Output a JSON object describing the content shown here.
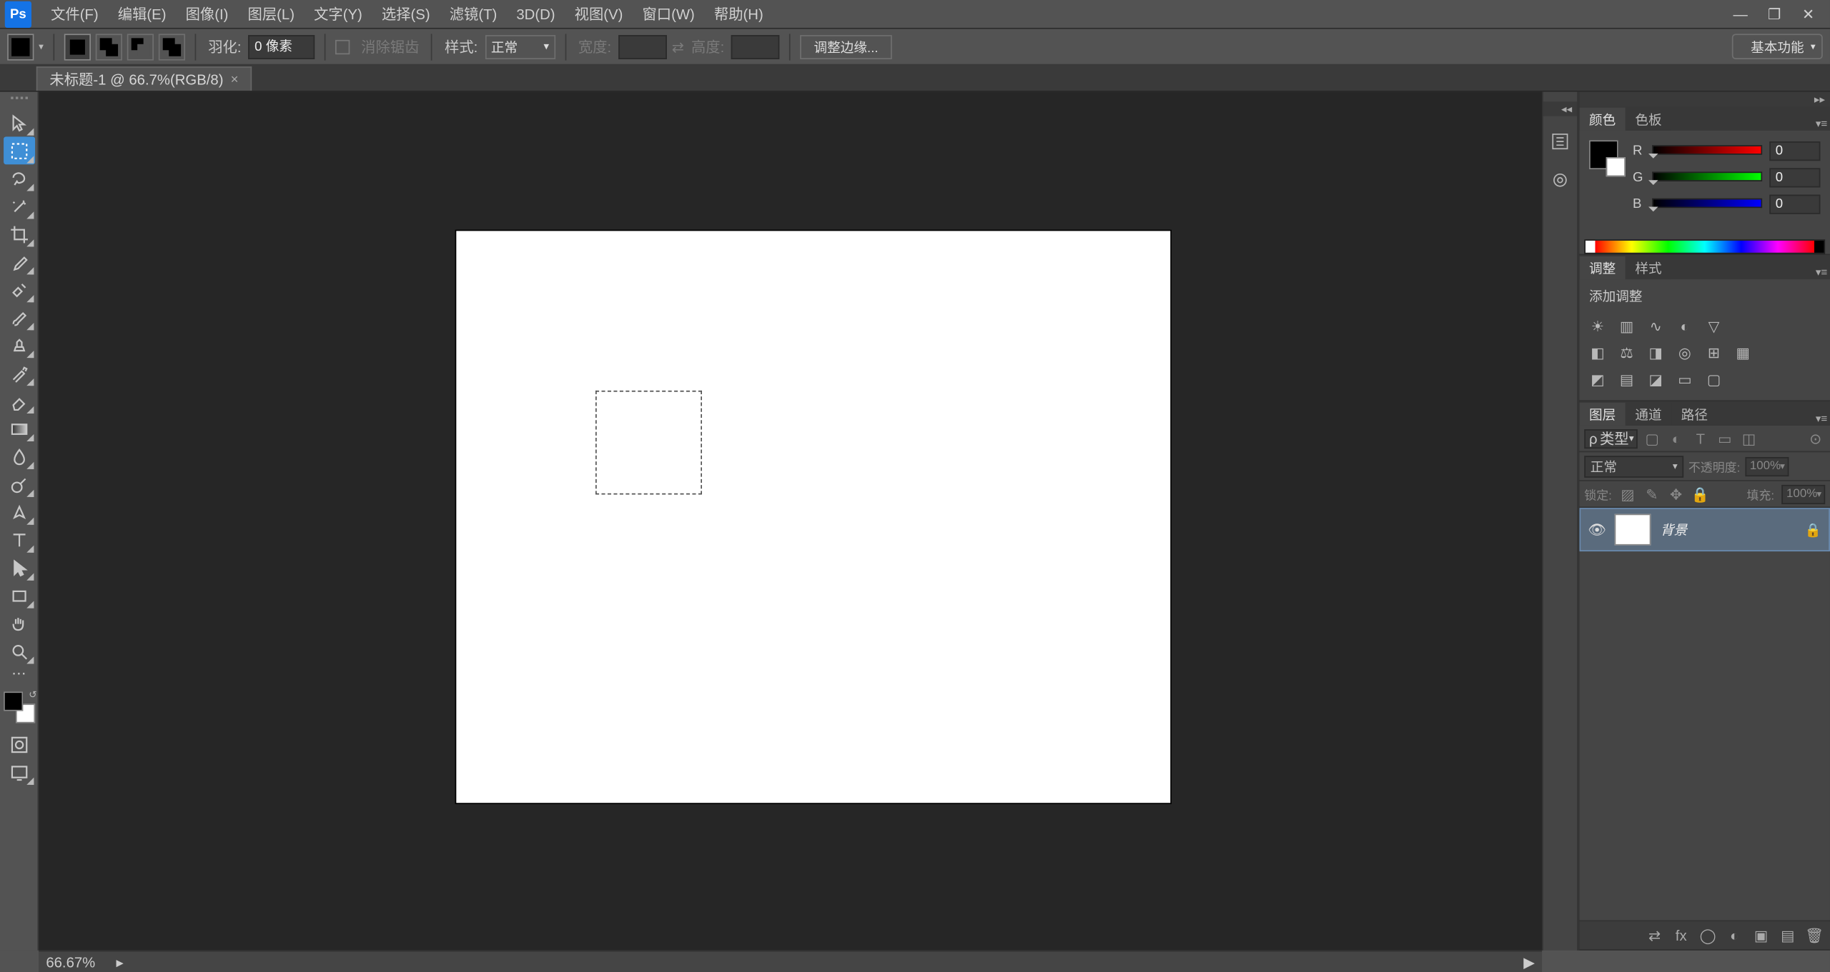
{
  "app_logo": "Ps",
  "menu": {
    "file": "文件(F)",
    "edit": "编辑(E)",
    "image": "图像(I)",
    "layer": "图层(L)",
    "type": "文字(Y)",
    "select": "选择(S)",
    "filter": "滤镜(T)",
    "3d": "3D(D)",
    "view": "视图(V)",
    "window": "窗口(W)",
    "help": "帮助(H)"
  },
  "optbar": {
    "feather_label": "羽化:",
    "feather_value": "0 像素",
    "antialias_label": "消除锯齿",
    "style_label": "样式:",
    "style_value": "正常",
    "width_label": "宽度:",
    "height_label": "高度:",
    "refine_edge": "调整边缘...",
    "workspace": "基本功能"
  },
  "document": {
    "tab_title": "未标题-1 @ 66.7%(RGB/8)"
  },
  "panels": {
    "color": {
      "tab": "颜色",
      "swatches_tab": "色板",
      "r": "R",
      "g": "G",
      "b": "B",
      "r_val": "0",
      "g_val": "0",
      "b_val": "0"
    },
    "adjustments": {
      "tab": "调整",
      "styles_tab": "样式",
      "title": "添加调整"
    },
    "layers": {
      "tab": "图层",
      "channels_tab": "通道",
      "paths_tab": "路径",
      "filter_kind": "类型",
      "blend_mode": "正常",
      "opacity_label": "不透明度:",
      "opacity_value": "100%",
      "lock_label": "锁定:",
      "fill_label": "填充:",
      "fill_value": "100%",
      "layer_name": "背景"
    }
  },
  "status": {
    "zoom": "66.67%"
  },
  "watermark": ""
}
